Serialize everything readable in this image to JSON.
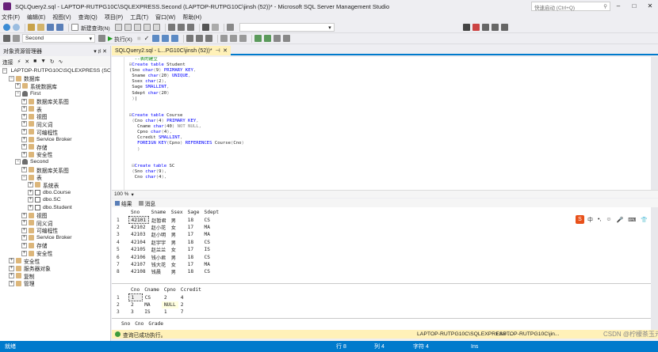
{
  "window": {
    "title": "SQLQuery2.sql - LAPTOP-RUTPG10C\\SQLEXPRESS.Second (LAPTOP-RUTPG10C\\jinsh (52))* - Microsoft SQL Server Management Studio",
    "quick_launch": "快速启动 (Ctrl+Q)",
    "min": "–",
    "max": "□",
    "close": "✕"
  },
  "menu": [
    "文件(F)",
    "编辑(E)",
    "视图(V)",
    "查询(Q)",
    "项目(P)",
    "工具(T)",
    "窗口(W)",
    "帮助(H)"
  ],
  "toolbar": {
    "new_query": "新建查询(N)",
    "database": "Second",
    "execute": "执行(X)"
  },
  "object_explorer": {
    "title": "对象资源管理器",
    "header_buttons": "▾ ♯ ✕",
    "connect": "连接",
    "tree": [
      {
        "level": 0,
        "exp": "⊟",
        "icon": "server",
        "label": "LAPTOP-RUTPG10C\\SQLEXPRESS (SC"
      },
      {
        "level": 1,
        "exp": "⊟",
        "icon": "folder",
        "label": "数据库"
      },
      {
        "level": 2,
        "exp": "⊞",
        "icon": "folder",
        "label": "系统数据库"
      },
      {
        "level": 2,
        "exp": "⊟",
        "icon": "db",
        "label": "First"
      },
      {
        "level": 3,
        "exp": "⊞",
        "icon": "folder",
        "label": "数据库关系图"
      },
      {
        "level": 3,
        "exp": "⊞",
        "icon": "folder",
        "label": "表"
      },
      {
        "level": 3,
        "exp": "⊞",
        "icon": "folder",
        "label": "视图"
      },
      {
        "level": 3,
        "exp": "⊞",
        "icon": "folder",
        "label": "同义词"
      },
      {
        "level": 3,
        "exp": "⊞",
        "icon": "folder",
        "label": "可编程性"
      },
      {
        "level": 3,
        "exp": "⊞",
        "icon": "folder",
        "label": "Service Broker"
      },
      {
        "level": 3,
        "exp": "⊞",
        "icon": "folder",
        "label": "存储"
      },
      {
        "level": 3,
        "exp": "⊞",
        "icon": "folder",
        "label": "安全性"
      },
      {
        "level": 2,
        "exp": "⊟",
        "icon": "db",
        "label": "Second"
      },
      {
        "level": 3,
        "exp": "⊞",
        "icon": "folder",
        "label": "数据库关系图"
      },
      {
        "level": 3,
        "exp": "⊟",
        "icon": "folder",
        "label": "表"
      },
      {
        "level": 4,
        "exp": "⊞",
        "icon": "folder",
        "label": "系统表"
      },
      {
        "level": 4,
        "exp": "⊞",
        "icon": "table",
        "label": "dbo.Course"
      },
      {
        "level": 4,
        "exp": "⊞",
        "icon": "table",
        "label": "dbo.SC"
      },
      {
        "level": 4,
        "exp": "⊞",
        "icon": "table",
        "label": "dbo.Student"
      },
      {
        "level": 3,
        "exp": "⊞",
        "icon": "folder",
        "label": "视图"
      },
      {
        "level": 3,
        "exp": "⊞",
        "icon": "folder",
        "label": "同义词"
      },
      {
        "level": 3,
        "exp": "⊞",
        "icon": "folder",
        "label": "可编程性"
      },
      {
        "level": 3,
        "exp": "⊞",
        "icon": "folder",
        "label": "Service Broker"
      },
      {
        "level": 3,
        "exp": "⊞",
        "icon": "folder",
        "label": "存储"
      },
      {
        "level": 3,
        "exp": "⊞",
        "icon": "folder",
        "label": "安全性"
      },
      {
        "level": 1,
        "exp": "⊞",
        "icon": "folder",
        "label": "安全性"
      },
      {
        "level": 1,
        "exp": "⊞",
        "icon": "folder",
        "label": "服务器对象"
      },
      {
        "level": 1,
        "exp": "⊞",
        "icon": "folder",
        "label": "复制"
      },
      {
        "level": 1,
        "exp": "⊞",
        "icon": "folder",
        "label": "管理"
      }
    ]
  },
  "editor": {
    "tab_title": "SQLQuery2.sql - L...PG10C\\jinsh (52))*",
    "zoom": "100 %",
    "lines": [
      [
        [
          "cm",
          "  --表的建立"
        ]
      ],
      [
        [
          "gr",
          "⊟"
        ],
        [
          "kw",
          "Create table"
        ],
        [
          "",
          " Student"
        ]
      ],
      [
        [
          "",
          "("
        ],
        [
          "",
          "Sno "
        ],
        [
          "kw",
          "char"
        ],
        [
          "gr",
          "("
        ],
        [
          "",
          "9"
        ],
        [
          "gr",
          ")"
        ],
        [
          "",
          " "
        ],
        [
          "kw",
          "PRIMARY KEY"
        ],
        [
          "gr",
          ","
        ]
      ],
      [
        [
          "",
          " Sname "
        ],
        [
          "kw",
          "char"
        ],
        [
          "gr",
          "("
        ],
        [
          "",
          "20"
        ],
        [
          "gr",
          ")"
        ],
        [
          "",
          " "
        ],
        [
          "kw",
          "UNIQUE"
        ],
        [
          "gr",
          ","
        ]
      ],
      [
        [
          "",
          " Ssex "
        ],
        [
          "kw",
          "char"
        ],
        [
          "gr",
          "("
        ],
        [
          "",
          "2"
        ],
        [
          "gr",
          ")"
        ],
        [
          "gr",
          ","
        ]
      ],
      [
        [
          "",
          " Sage "
        ],
        [
          "kw",
          "SMALLINT"
        ],
        [
          "gr",
          ","
        ]
      ],
      [
        [
          "",
          " Sdept "
        ],
        [
          "kw",
          "char"
        ],
        [
          "gr",
          "("
        ],
        [
          "",
          "20"
        ],
        [
          "gr",
          ")"
        ]
      ],
      [
        [
          "gr",
          " )"
        ],
        [
          "",
          "|"
        ]
      ],
      [
        [
          "",
          ""
        ]
      ],
      [
        [
          "",
          ""
        ]
      ],
      [
        [
          "gr",
          "⊟"
        ],
        [
          "kw",
          "Create table"
        ],
        [
          "",
          " Course"
        ]
      ],
      [
        [
          "gr",
          " ("
        ],
        [
          "",
          "Cno "
        ],
        [
          "kw",
          "char"
        ],
        [
          "gr",
          "("
        ],
        [
          "",
          "4"
        ],
        [
          "gr",
          ")"
        ],
        [
          "",
          " "
        ],
        [
          "kw",
          "PRIMARY KEY"
        ],
        [
          "gr",
          ","
        ]
      ],
      [
        [
          "",
          "   Cname "
        ],
        [
          "kw",
          "char"
        ],
        [
          "gr",
          "("
        ],
        [
          "",
          "40"
        ],
        [
          "gr",
          ")"
        ],
        [
          "",
          " "
        ],
        [
          "gr",
          "NOT NULL"
        ],
        [
          "gr",
          ","
        ]
      ],
      [
        [
          "",
          "   Cpno "
        ],
        [
          "kw",
          "char"
        ],
        [
          "gr",
          "("
        ],
        [
          "",
          "4"
        ],
        [
          "gr",
          ")"
        ],
        [
          "gr",
          ","
        ]
      ],
      [
        [
          "",
          "   Ccredit "
        ],
        [
          "kw",
          "SMALLINT"
        ],
        [
          "gr",
          ","
        ]
      ],
      [
        [
          "",
          "   "
        ],
        [
          "kw",
          "FOREIGN KEY"
        ],
        [
          "gr",
          "("
        ],
        [
          "",
          "Cpno"
        ],
        [
          "gr",
          ")"
        ],
        [
          "",
          " "
        ],
        [
          "kw",
          "REFERENCES"
        ],
        [
          "",
          " Course"
        ],
        [
          "gr",
          "("
        ],
        [
          "",
          "Cno"
        ],
        [
          "gr",
          ")"
        ]
      ],
      [
        [
          "gr",
          "   )"
        ]
      ],
      [
        [
          "",
          ""
        ]
      ],
      [
        [
          "",
          ""
        ]
      ],
      [
        [
          "gr",
          " ⊟"
        ],
        [
          "kw",
          "Create table"
        ],
        [
          "",
          " SC"
        ]
      ],
      [
        [
          "gr",
          " ("
        ],
        [
          "",
          "Sno "
        ],
        [
          "kw",
          "char"
        ],
        [
          "gr",
          "("
        ],
        [
          "",
          "9"
        ],
        [
          "gr",
          ")"
        ],
        [
          "gr",
          ","
        ]
      ],
      [
        [
          "",
          "  Cno "
        ],
        [
          "kw",
          "char"
        ],
        [
          "gr",
          "("
        ],
        [
          "",
          "4"
        ],
        [
          "gr",
          ")"
        ],
        [
          "gr",
          ","
        ]
      ]
    ]
  },
  "results": {
    "tab_results": "结果",
    "tab_messages": "消息",
    "grid1": {
      "columns": [
        "Sno",
        "Sname",
        "Ssex",
        "Sage",
        "Sdept"
      ],
      "rows": [
        [
          "1",
          "42101",
          "赵暂君",
          "男",
          "18",
          "CS"
        ],
        [
          "2",
          "42102",
          "赵小花",
          "女",
          "17",
          "MA"
        ],
        [
          "3",
          "42103",
          "赵小明",
          "男",
          "17",
          "MA"
        ],
        [
          "4",
          "42104",
          "赵宇宇",
          "男",
          "18",
          "CS"
        ],
        [
          "5",
          "42105",
          "赵兰兰",
          "女",
          "17",
          "IS"
        ],
        [
          "6",
          "42106",
          "钱小君",
          "男",
          "18",
          "CS"
        ],
        [
          "7",
          "42107",
          "钱大花",
          "女",
          "17",
          "MA"
        ],
        [
          "8",
          "42108",
          "钱晨",
          "男",
          "18",
          "CS"
        ]
      ]
    },
    "grid2": {
      "columns": [
        "Cno",
        "Cname",
        "Cpno",
        "Ccredit"
      ],
      "rows": [
        [
          "1",
          "1",
          "CS",
          "2",
          "4"
        ],
        [
          "2",
          "2",
          "MA",
          "NULL",
          "2"
        ],
        [
          "3",
          "3",
          "IS",
          "1",
          "7"
        ]
      ]
    },
    "grid3": {
      "columns": [
        "Sno",
        "Cno",
        "Grade"
      ]
    },
    "ime": {
      "logo": "S",
      "items": [
        "中",
        "•,",
        "☺",
        "🎤",
        "⌨",
        "👕",
        "⊞"
      ]
    }
  },
  "query_status": {
    "message": "查询已成功执行。",
    "server": "LAPTOP-RUTPG10C\\SQLEXPRESS ...",
    "server2": "LAPTOP-RUTPG10C\\jin...",
    "watermark": "CSDN @柠檬茶玉元"
  },
  "statusbar": {
    "ready": "就绪",
    "line": "行 8",
    "col": "列 4",
    "char": "字符 4",
    "ins": "Ins"
  },
  "colors": {
    "accent": "#007acc",
    "tab_active": "#fff1b8",
    "keyword": "#0000ff",
    "comment": "#008000"
  }
}
